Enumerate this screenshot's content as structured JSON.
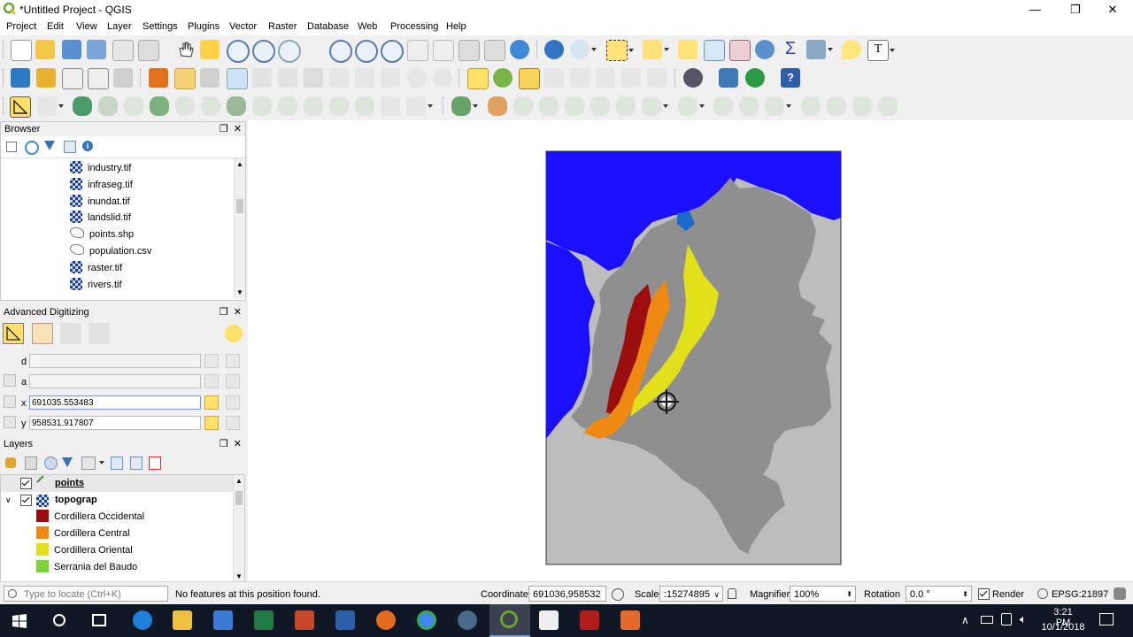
{
  "window": {
    "title": "*Untitled Project - QGIS",
    "controls": [
      "—",
      "❐",
      "✕"
    ]
  },
  "menu": [
    "Project",
    "Edit",
    "View",
    "Layer",
    "Settings",
    "Plugins",
    "Vector",
    "Raster",
    "Database",
    "Web",
    "Processing",
    "Help"
  ],
  "browser": {
    "title": "Browser",
    "items": [
      {
        "label": "industry.tif",
        "kind": "raster"
      },
      {
        "label": "infraseg.tif",
        "kind": "raster"
      },
      {
        "label": "inundat.tif",
        "kind": "raster"
      },
      {
        "label": "landslid.tif",
        "kind": "raster"
      },
      {
        "label": "points.shp",
        "kind": "vector"
      },
      {
        "label": "population.csv",
        "kind": "vector"
      },
      {
        "label": "raster.tif",
        "kind": "raster"
      },
      {
        "label": "rivers.tif",
        "kind": "raster"
      }
    ]
  },
  "advanced_digitizing": {
    "title": "Advanced Digitizing",
    "d_label": "d",
    "a_label": "a",
    "x_label": "x",
    "y_label": "y",
    "d_value": "",
    "a_value": "",
    "x_value": "691035.553483",
    "y_value": "958531.917807"
  },
  "layers": {
    "title": "Layers",
    "items": [
      {
        "label": "points",
        "checked": true
      },
      {
        "label": "topograp",
        "checked": true
      }
    ],
    "legend": [
      {
        "label": "Cordillera Occidental",
        "color": "#9a0e0e"
      },
      {
        "label": "Cordillera Central",
        "color": "#ee8a12"
      },
      {
        "label": "Cordillera Oriental",
        "color": "#e2e01a"
      },
      {
        "label": "Serrania del Baudo",
        "color": "#7ed23a"
      }
    ]
  },
  "map": {
    "ocean_color": "#1a10ff",
    "land_color": "#8f8f8f",
    "neighbor_color": "#bdbdbd"
  },
  "status": {
    "locate_placeholder": "Type to locate (Ctrl+K)",
    "message": "No features at this position found.",
    "coordinate_label": "Coordinate",
    "coordinate_value": "691036,958532",
    "scale_label": "Scale",
    "scale_value": ":15274895",
    "magnifier_label": "Magnifier",
    "magnifier_value": "100%",
    "rotation_label": "Rotation",
    "rotation_value": "0.0 °",
    "render_label": "Render",
    "crs": "EPSG:21897"
  },
  "taskbar": {
    "time": "3:21 PM",
    "date": "10/1/2018"
  }
}
